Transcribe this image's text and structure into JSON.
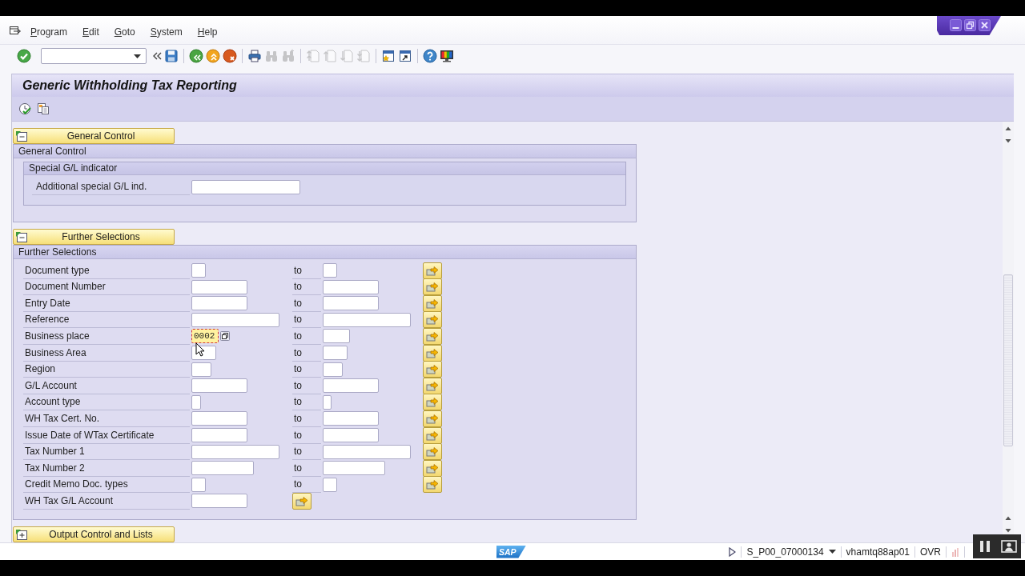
{
  "menu": [
    "Program",
    "Edit",
    "Goto",
    "System",
    "Help"
  ],
  "toolbar": {
    "buttons": [
      {
        "disabled": false
      },
      {
        "disabled": false
      },
      {
        "disabled": false
      },
      {
        "disabled": false
      },
      {
        "disabled": false
      },
      {
        "disabled": false
      },
      {
        "disabled": true
      },
      {
        "disabled": true
      },
      {
        "disabled": true
      },
      {
        "disabled": true
      },
      {
        "disabled": true
      },
      {
        "disabled": true
      },
      {
        "disabled": false
      },
      {
        "disabled": false
      },
      {
        "disabled": false
      },
      {
        "disabled": false
      }
    ]
  },
  "title": "Generic Withholding Tax Reporting",
  "blocks": [
    {
      "button": "General Control",
      "expanded": true,
      "title": "General Control",
      "groups": [
        {
          "title": "Special G/L indicator",
          "rows": [
            {
              "kind": "parameter",
              "label": "Additional special G/L ind.",
              "focused": false
            }
          ]
        }
      ]
    },
    {
      "button": "Further Selections",
      "expanded": true,
      "title": "Further Selections",
      "rows": [
        {
          "kind": "select_option",
          "label": "Document type",
          "to": "to",
          "focused": false
        },
        {
          "kind": "select_option",
          "label": "Document Number",
          "to": "to",
          "focused": false
        },
        {
          "kind": "select_option",
          "label": "Entry Date",
          "to": "to",
          "focused": false
        },
        {
          "kind": "select_option",
          "label": "Reference",
          "to": "to",
          "focused": false
        },
        {
          "kind": "select_option",
          "label": "Business place",
          "value": "0002",
          "to": "to",
          "focused": true
        },
        {
          "kind": "select_option",
          "label": "Business Area",
          "to": "to",
          "focused": false
        },
        {
          "kind": "select_option",
          "label": "Region",
          "to": "to",
          "focused": false
        },
        {
          "kind": "select_option",
          "label": "G/L Account",
          "to": "to",
          "focused": false
        },
        {
          "kind": "select_option",
          "label": "Account type",
          "to": "to",
          "focused": false
        },
        {
          "kind": "select_option",
          "label": "WH Tax Cert. No.",
          "to": "to",
          "focused": false
        },
        {
          "kind": "select_option",
          "label": "Issue Date of WTax Certificate",
          "to": "to",
          "focused": false
        },
        {
          "kind": "select_option",
          "label": "Tax Number 1",
          "to": "to",
          "focused": false
        },
        {
          "kind": "select_option",
          "label": "Tax Number 2",
          "to": "to",
          "focused": false
        },
        {
          "kind": "select_option",
          "label": "Credit Memo Doc. types",
          "to": "to",
          "focused": false
        },
        {
          "kind": "select_option",
          "label": "WH Tax G/L Account",
          "focused": false
        }
      ]
    },
    {
      "button": "Output Control and Lists",
      "expanded": false
    }
  ],
  "status_bar": {
    "logo": "SAP",
    "session": "S_P00_07000134",
    "server": "vhamtq88ap01",
    "mode": "OVR"
  }
}
